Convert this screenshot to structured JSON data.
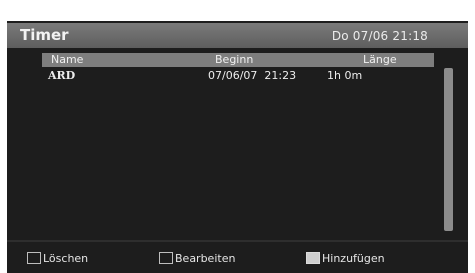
{
  "header": {
    "title": "Timer",
    "datetime": "Do 07/06 21:18"
  },
  "table": {
    "columns": [
      "Name",
      "Beginn",
      "Länge"
    ],
    "rows": [
      {
        "name": "ARD",
        "begin": "07/06/07  21:23",
        "length": "1h 0m"
      }
    ]
  },
  "footer": {
    "delete_label": "Löschen",
    "edit_label": "Bearbeiten",
    "add_label": "Hinzufügen"
  }
}
